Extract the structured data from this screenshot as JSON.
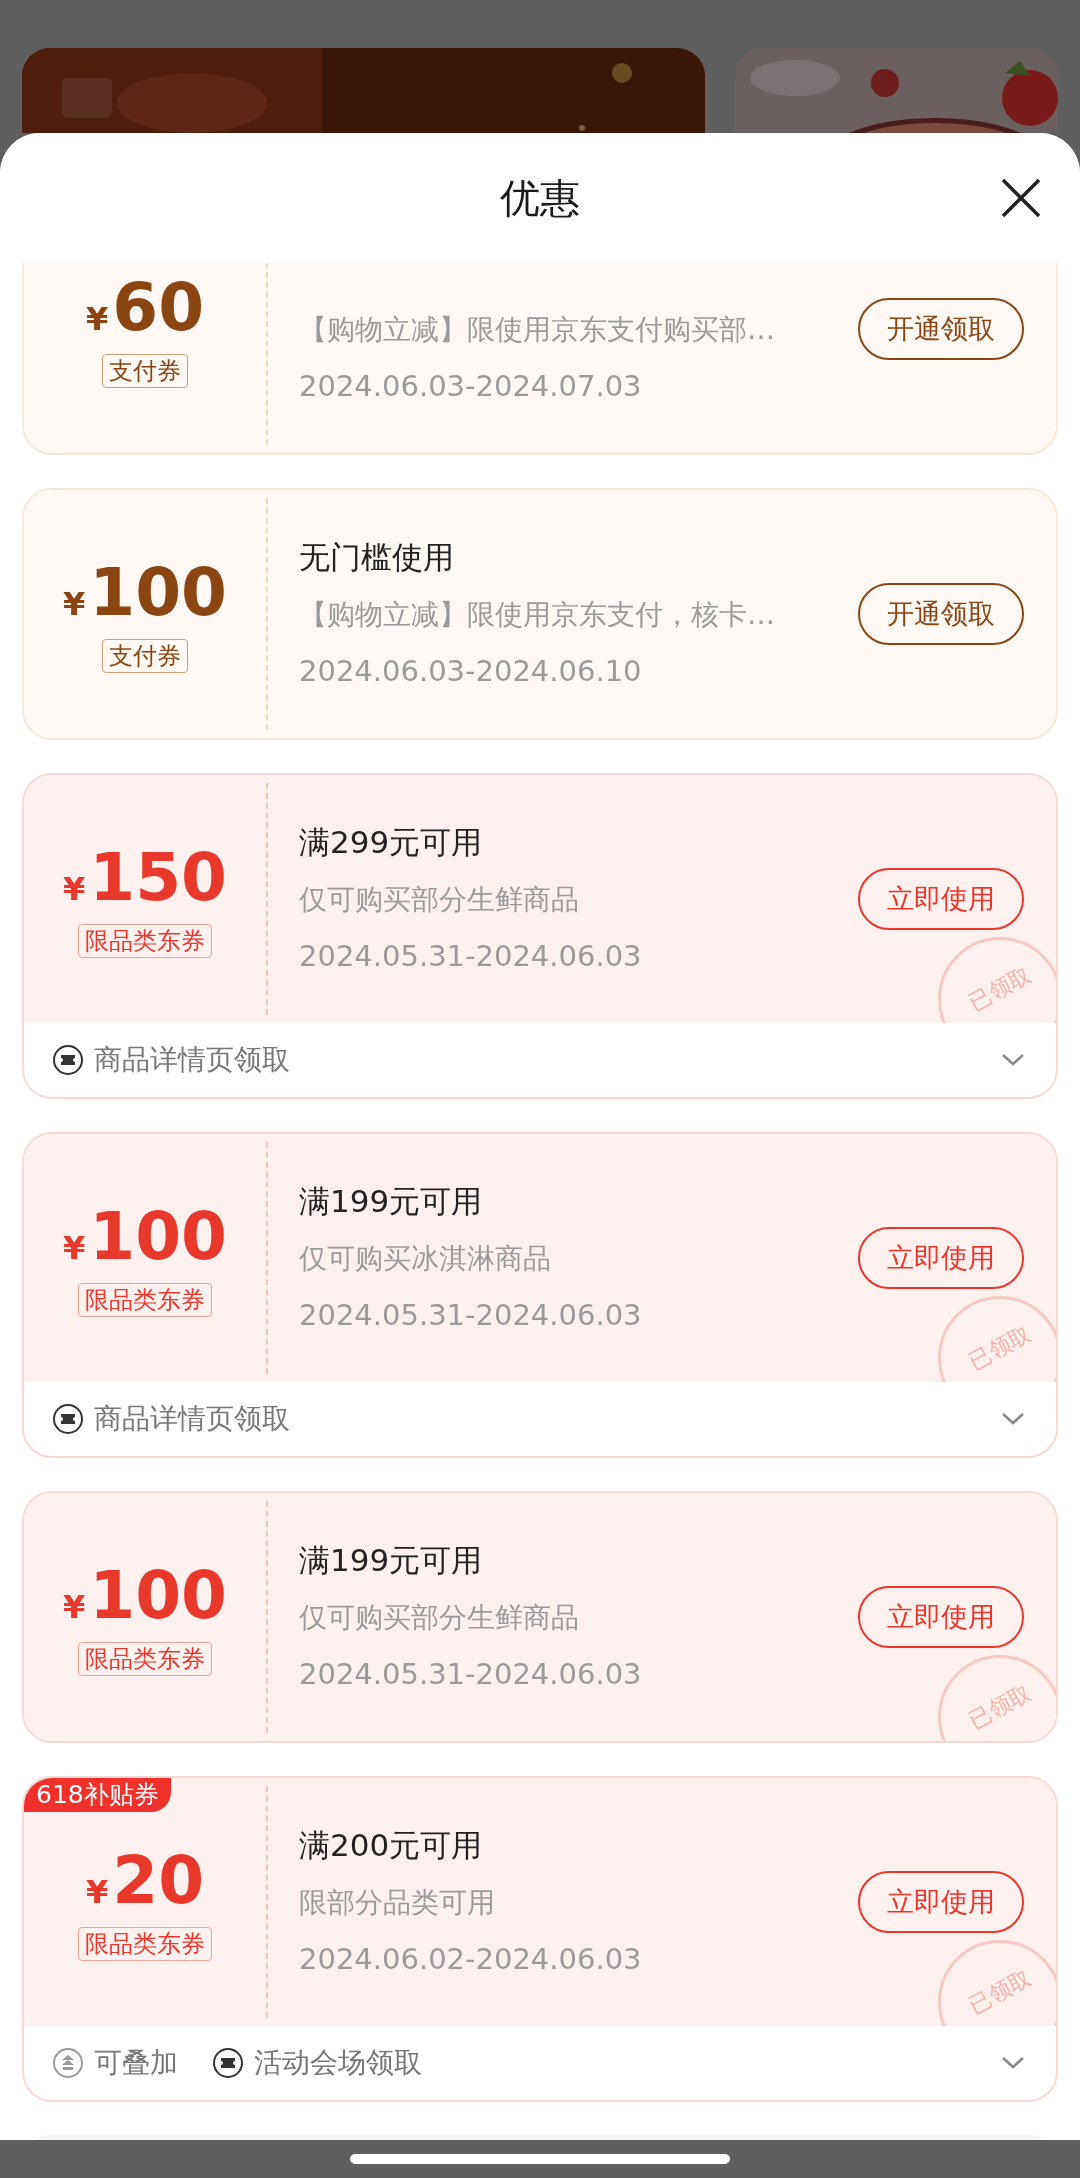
{
  "sheet": {
    "title": "优惠"
  },
  "coupons": [
    {
      "kind": "pay",
      "currency": "¥",
      "amount": "60",
      "tag": "支付券",
      "description": "【购物立减】限使用京东支付购买部…",
      "validity": "2024.06.03-2024.07.03",
      "button": "开通领取"
    },
    {
      "kind": "pay",
      "currency": "¥",
      "amount": "100",
      "tag": "支付券",
      "title": "无门槛使用",
      "description": "【购物立减】限使用京东支付，核卡…",
      "validity": "2024.06.03-2024.06.10",
      "button": "开通领取"
    },
    {
      "kind": "category",
      "currency": "¥",
      "amount": "150",
      "tag": "限品类东券",
      "title": "满299元可用",
      "description": "仅可购买部分生鲜商品",
      "validity": "2024.05.31-2024.06.03",
      "button": "立即使用",
      "stamp": "已领取",
      "footer": [
        {
          "kind": "ticket",
          "text": "商品详情页领取"
        }
      ]
    },
    {
      "kind": "category",
      "currency": "¥",
      "amount": "100",
      "tag": "限品类东券",
      "title": "满199元可用",
      "description": "仅可购买冰淇淋商品",
      "validity": "2024.05.31-2024.06.03",
      "button": "立即使用",
      "stamp": "已领取",
      "footer": [
        {
          "kind": "ticket",
          "text": "商品详情页领取"
        }
      ]
    },
    {
      "kind": "category",
      "currency": "¥",
      "amount": "100",
      "tag": "限品类东券",
      "title": "满199元可用",
      "description": "仅可购买部分生鲜商品",
      "validity": "2024.05.31-2024.06.03",
      "button": "立即使用",
      "stamp": "已领取"
    },
    {
      "kind": "category",
      "badge": "618补贴券",
      "currency": "¥",
      "amount": "20",
      "tag": "限品类东券",
      "title": "满200元可用",
      "description": "限部分品类可用",
      "validity": "2024.06.02-2024.06.03",
      "button": "立即使用",
      "stamp": "已领取",
      "footer": [
        {
          "kind": "stack",
          "text": "可叠加"
        },
        {
          "kind": "ticket",
          "text": "活动会场领取"
        }
      ]
    }
  ]
}
